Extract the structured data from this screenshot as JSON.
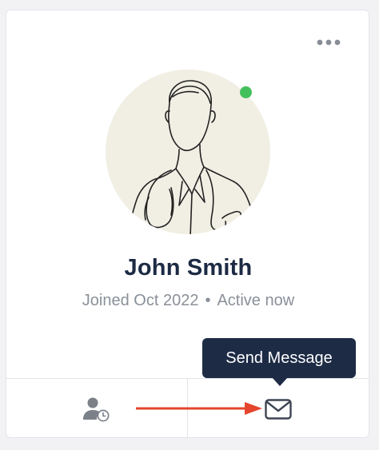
{
  "profile": {
    "name": "John Smith",
    "joined": "Joined Oct 2022",
    "separator": "•",
    "status": "Active now",
    "online": true
  },
  "actions": {
    "more_icon": "more-horizontal-icon",
    "left_icon": "user-clock-icon",
    "right_icon": "mail-icon"
  },
  "tooltip": {
    "text": "Send Message"
  },
  "colors": {
    "name": "#1c2a43",
    "meta": "#8a9099",
    "online_dot": "#43c05c",
    "tooltip_bg": "#1d2b45",
    "avatar_bg": "#f1efe4",
    "arrow": "#e5452d"
  }
}
